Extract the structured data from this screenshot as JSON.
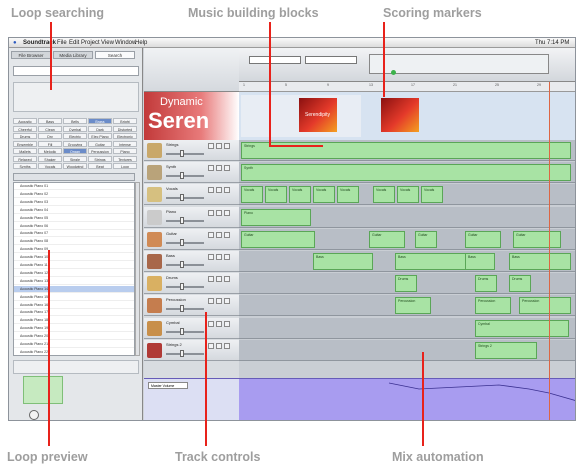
{
  "callouts": {
    "top": [
      "Loop searching",
      "Music building blocks",
      "Scoring markers"
    ],
    "bottom": [
      "Loop preview",
      "Track controls",
      "Mix automation"
    ]
  },
  "app": {
    "menu": [
      "Soundtrack",
      "File",
      "Edit",
      "Project",
      "View",
      "Window",
      "Help"
    ],
    "clock": "Thu 7:14 PM"
  },
  "browser_tabs": [
    "File Browser",
    "Media Library",
    "Search"
  ],
  "search_keywords": [
    [
      "Acoustic",
      "Bass",
      "Bells",
      "Brass",
      "Bright"
    ],
    [
      "Cheerful",
      "Clean",
      "Cymbal",
      "Dark",
      "Distorted"
    ],
    [
      "Drums",
      "Dry",
      "Electric",
      "Elec Piano",
      "Electronic"
    ],
    [
      "Ensemble",
      "Fill",
      "Grooving",
      "Guitar",
      "Intense"
    ],
    [
      "Mallets",
      "Melodic",
      "Organ",
      "Percussion",
      "Piano"
    ],
    [
      "Relaxed",
      "Shaker",
      "Single",
      "Strings",
      "Textures"
    ],
    [
      "Synths",
      "Vocals",
      "Woodwind",
      "Beat",
      "Loop"
    ]
  ],
  "loops": [
    "Acoustic Piano 01",
    "Acoustic Piano 02",
    "Acoustic Piano 03",
    "Acoustic Piano 04",
    "Acoustic Piano 05",
    "Acoustic Piano 06",
    "Acoustic Piano 07",
    "Acoustic Piano 08",
    "Acoustic Piano 09",
    "Acoustic Piano 10",
    "Acoustic Piano 11",
    "Acoustic Piano 12",
    "Acoustic Piano 13",
    "Acoustic Piano 14",
    "Acoustic Piano 15",
    "Acoustic Piano 16",
    "Acoustic Piano 17",
    "Acoustic Piano 18",
    "Acoustic Piano 19",
    "Acoustic Piano 20",
    "Acoustic Piano 21",
    "Acoustic Piano 22"
  ],
  "video": {
    "title_prefix": "Dynamic",
    "title": "Seren",
    "thumb": "Serendipity"
  },
  "tracks": [
    {
      "name": "Strings",
      "icon_color": "#c9a86a"
    },
    {
      "name": "Synth",
      "icon_color": "#b9a37a"
    },
    {
      "name": "Vocals",
      "icon_color": "#d6c080"
    },
    {
      "name": "Piano",
      "icon_color": "#cbcbcb"
    },
    {
      "name": "Guitar",
      "icon_color": "#d08a55"
    },
    {
      "name": "Bass",
      "icon_color": "#a8674a"
    },
    {
      "name": "Drums",
      "icon_color": "#d9b062"
    },
    {
      "name": "Percussion",
      "icon_color": "#c57d4e"
    },
    {
      "name": "Cymbal",
      "icon_color": "#c88f4a"
    },
    {
      "name": "Strings 2",
      "icon_color": "#b03a36"
    }
  ],
  "automation_label": "Master Volume",
  "ruler_ticks": [
    "1",
    "5",
    "9",
    "13",
    "17",
    "21",
    "25",
    "29"
  ]
}
